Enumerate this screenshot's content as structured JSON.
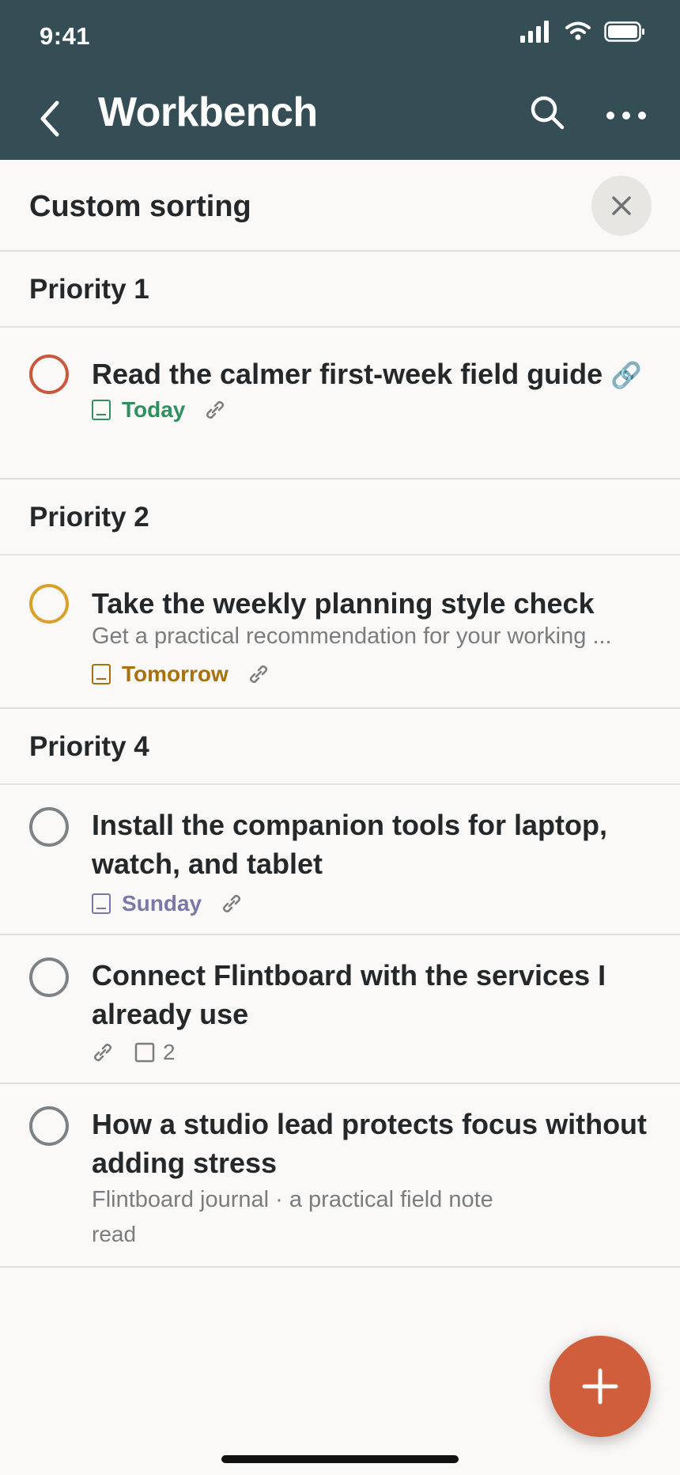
{
  "status_bar": {
    "time": "9:41"
  },
  "header": {
    "title": "Workbench"
  },
  "sort_bar": {
    "title": "Custom sorting"
  },
  "sections": [
    {
      "heading": "Priority 1",
      "tasks": [
        {
          "title": "Read the calmer first-week field guide",
          "title_link_glyph": "🔗",
          "due": "Today",
          "due_color": "#2f8f5e",
          "check_color": "#c9583d"
        }
      ]
    },
    {
      "heading": "Priority 2",
      "tasks": [
        {
          "title": "Take the weekly planning style check",
          "description": "Get a practical recommendation for your working ...",
          "due": "Tomorrow",
          "due_color": "#a8700f",
          "check_color": "#d9a02a"
        }
      ]
    },
    {
      "heading": "Priority 4",
      "tasks": [
        {
          "title": "Install the companion tools for laptop, watch, and tablet",
          "due": "Sunday",
          "due_color": "#7a78a8",
          "check_color": "#7c8286"
        },
        {
          "title": "Connect Flintboard with the services I already use",
          "subtask_count": "2",
          "check_color": "#7c8286"
        },
        {
          "title": "How a studio lead protects focus without adding stress",
          "description": "Flintboard journal · a practical field note",
          "note": "read",
          "check_color": "#7c8286"
        }
      ]
    }
  ],
  "icons": {
    "back": "chevron-left-icon",
    "search": "search-icon",
    "more": "more-icon",
    "close": "close-icon",
    "add": "plus-icon",
    "link": "link-icon",
    "calendar": "calendar-icon",
    "subtask": "checkbox-icon"
  },
  "colors": {
    "header_bg": "#354d55",
    "fab": "#d05d3b"
  }
}
